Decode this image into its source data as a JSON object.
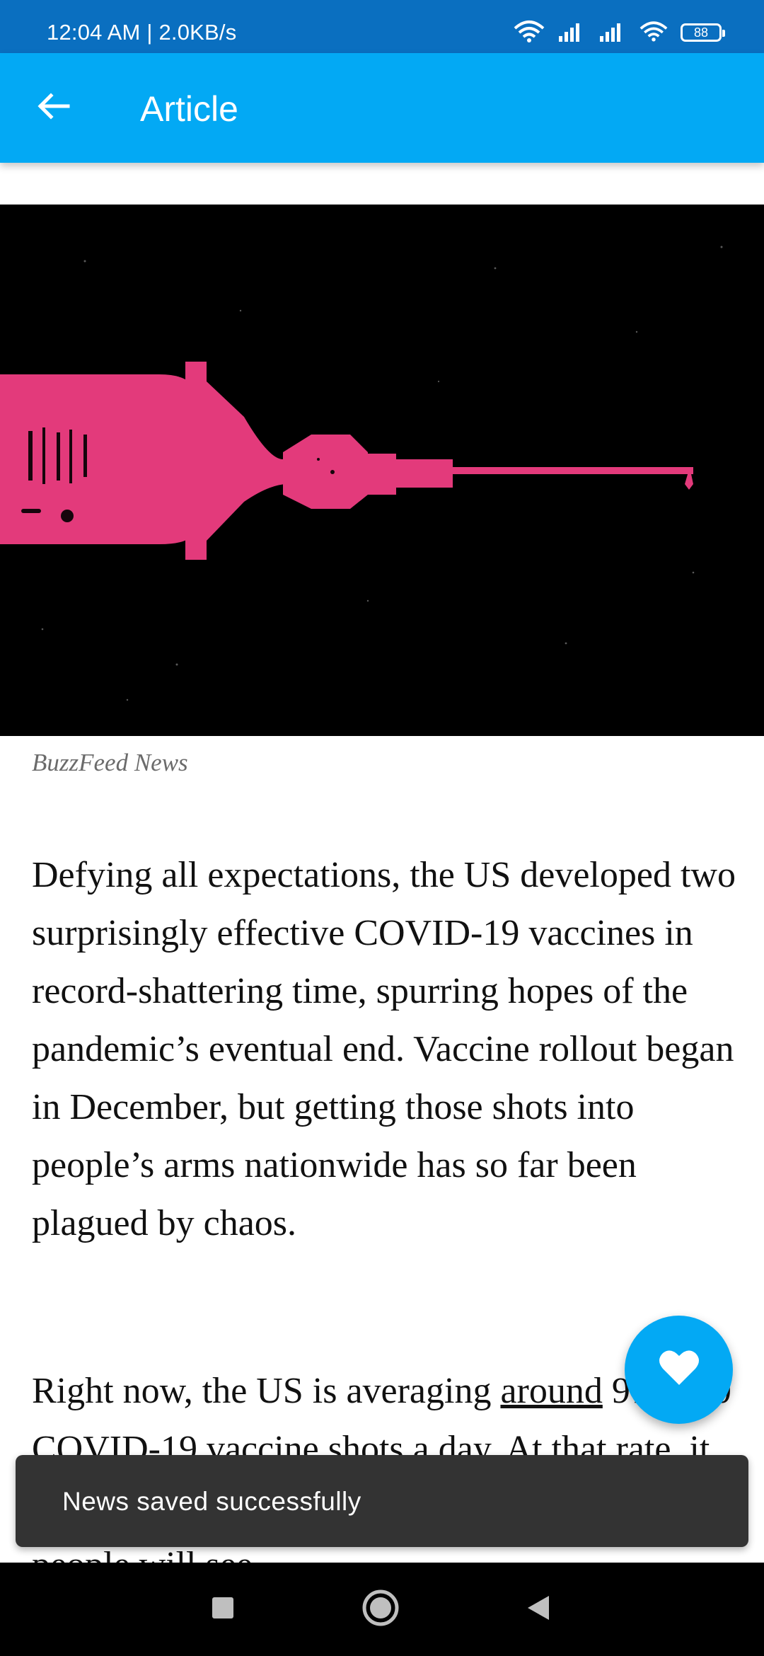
{
  "status_bar": {
    "time": "12:04 AM | 2.0KB/s",
    "battery": "88"
  },
  "app_bar": {
    "title": "Article",
    "back_icon": "arrow-left-icon"
  },
  "article": {
    "image_caption": "BuzzFeed News",
    "paragraph1": "Defying all expectations, the US developed two surprisingly effective COVID-19 vaccines in record-shattering time, spurring hopes of the pandemic’s eventual end. Vaccine rollout began in December, but getting those shots into people’s arms nationwide has so far been plagued by chaos.",
    "paragraph2_prefix": "Right now, the US is averaging ",
    "paragraph2_link": "around",
    "paragraph2_rest": " 970,000 COVID-19 vaccine shots a day. At that rate, it will take years before the country’s 330 million people will see"
  },
  "fab": {
    "icon": "heart-icon"
  },
  "snackbar": {
    "message": "News saved successfully"
  },
  "nav_bar": {
    "recents_icon": "square-icon",
    "home_icon": "circle-icon",
    "back_icon": "triangle-back-icon"
  },
  "colors": {
    "status_bar": "#0a6fc0",
    "app_bar": "#03a9f4",
    "fab": "#03a9f4",
    "snackbar": "#333333",
    "syringe": "#e33a7b"
  }
}
